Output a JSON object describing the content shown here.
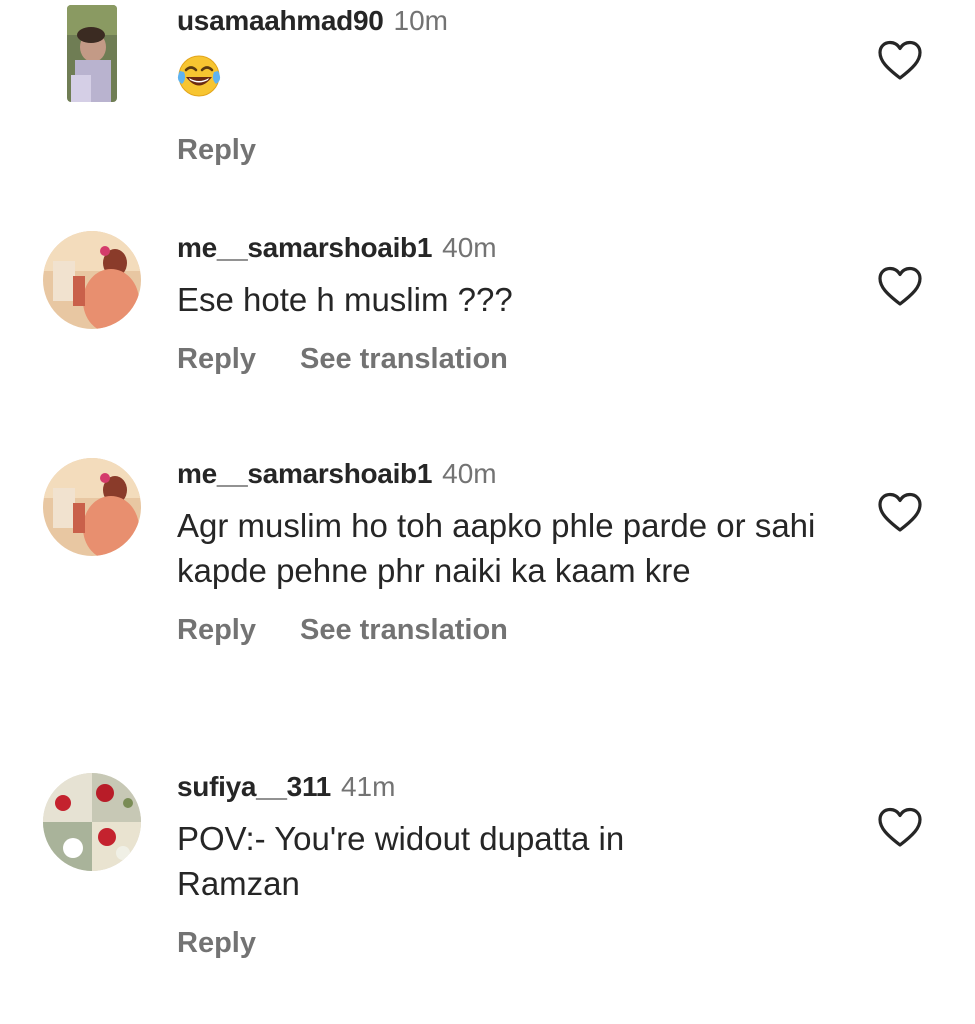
{
  "comments": [
    {
      "username": "usamaahmad90",
      "time": "10m",
      "text": "😂",
      "reply_label": "Reply",
      "translate_label": "",
      "like_icon": "heart-outline-icon"
    },
    {
      "username": "me__samarshoaib1",
      "time": "40m",
      "text": "Ese hote h muslim ???",
      "reply_label": "Reply",
      "translate_label": "See translation",
      "like_icon": "heart-outline-icon"
    },
    {
      "username": "me__samarshoaib1",
      "time": "40m",
      "text": "Agr muslim ho toh aapko phle parde or sahi kapde pehne phr naiki ka kaam kre",
      "reply_label": "Reply",
      "translate_label": "See translation",
      "like_icon": "heart-outline-icon"
    },
    {
      "username": "sufiya__311",
      "time": "41m",
      "text": "POV:- You're widout dupatta in Ramzan",
      "reply_label": "Reply",
      "translate_label": "",
      "like_icon": "heart-outline-icon"
    }
  ],
  "colors": {
    "text_primary": "#262626",
    "text_secondary": "#737373",
    "background": "#ffffff"
  }
}
